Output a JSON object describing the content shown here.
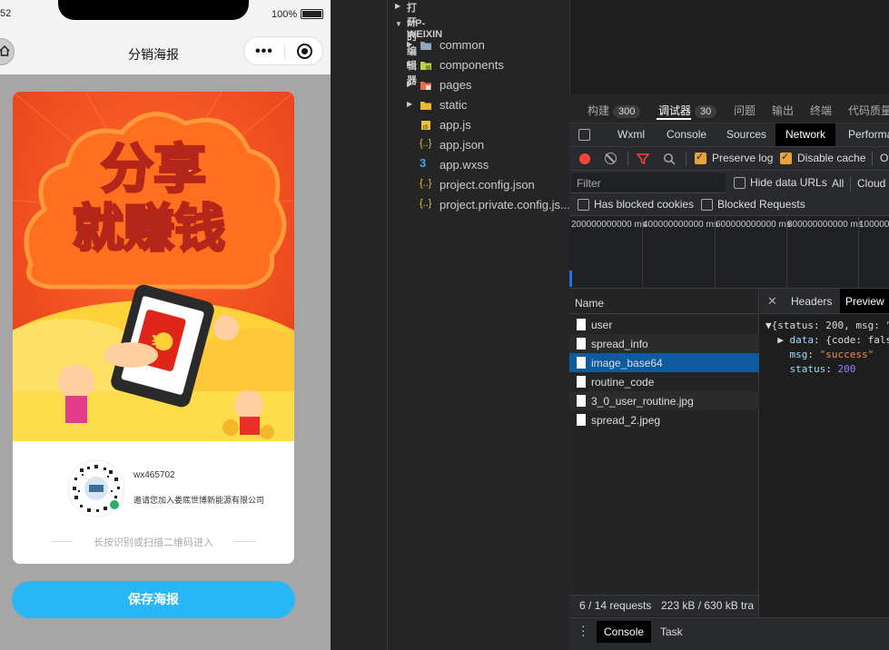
{
  "phone": {
    "status_time": "52",
    "battery": "100%",
    "nav_title": "分销海报",
    "poster": {
      "headline_line1": "分享",
      "headline_line2": "就赚钱",
      "yen": "¥",
      "qr_user": "wx465702",
      "qr_invite": "邀请您加入娄底世博新能源有限公司",
      "qr_tip": "长按识别或扫描二维码进入"
    },
    "save_button": "保存海报"
  },
  "explorer": {
    "open_editors": "打开的编辑器",
    "project": "MP-WEIXIN",
    "items": [
      {
        "label": "common",
        "type": "folder",
        "icon": "folder-icon",
        "color": "#8fa7b8"
      },
      {
        "label": "components",
        "type": "folder",
        "icon": "folder-components-icon",
        "color": "#b8d44a"
      },
      {
        "label": "pages",
        "type": "folder",
        "icon": "folder-pages-icon",
        "color": "#ee6b4d"
      },
      {
        "label": "static",
        "type": "folder",
        "icon": "folder-static-icon",
        "color": "#e9b92b"
      },
      {
        "label": "app.js",
        "type": "file",
        "icon": "js-file-icon",
        "color": "#e8c53a"
      },
      {
        "label": "app.json",
        "type": "file",
        "icon": "json-file-icon",
        "color": "#e8c53a"
      },
      {
        "label": "app.wxss",
        "type": "file",
        "icon": "css-file-icon",
        "color": "#42a5f5"
      },
      {
        "label": "project.config.json",
        "type": "file",
        "icon": "json-file-icon",
        "color": "#e8c53a"
      },
      {
        "label": "project.private.config.js...",
        "type": "file",
        "icon": "json-file-icon",
        "color": "#e8c53a"
      }
    ]
  },
  "devtools": {
    "panel_tabs": [
      {
        "label": "构建",
        "badge": "300"
      },
      {
        "label": "调试器",
        "badge": "30",
        "active": true
      },
      {
        "label": "问题"
      },
      {
        "label": "输出"
      },
      {
        "label": "终端"
      },
      {
        "label": "代码质量"
      }
    ],
    "tabs": [
      "Wxml",
      "Console",
      "Sources",
      "Network",
      "Performa"
    ],
    "active_tab": "Network",
    "toolbar": {
      "preserve_log": "Preserve log",
      "disable_cache": "Disable cache",
      "extra": "O"
    },
    "filter": {
      "placeholder": "Filter",
      "hide_data_urls": "Hide data URLs",
      "all": "All",
      "cloud": "Cloud",
      "has_blocked_cookies": "Has blocked cookies",
      "blocked_requests": "Blocked Requests"
    },
    "timeline_labels": [
      "200000000000 ms",
      "400000000000 ms",
      "600000000000 ms",
      "800000000000 ms",
      "1000000000000"
    ],
    "name_header": "Name",
    "requests": [
      "user",
      "spread_info",
      "image_base64",
      "routine_code",
      "3_0_user_routine.jpg",
      "spread_2.jpeg"
    ],
    "selected_request": "image_base64",
    "summary_requests": "6 / 14 requests",
    "summary_size": "223 kB / 630 kB tra",
    "detail_tabs": [
      "Headers",
      "Preview"
    ],
    "preview": {
      "line1": "{status: 200, msg: \"",
      "data_key": "data",
      "data_val": "{code: fals",
      "msg_key": "msg",
      "msg_val": "\"success\"",
      "status_key": "status",
      "status_val": "200"
    },
    "drawer_tabs": [
      "Console",
      "Task"
    ]
  }
}
